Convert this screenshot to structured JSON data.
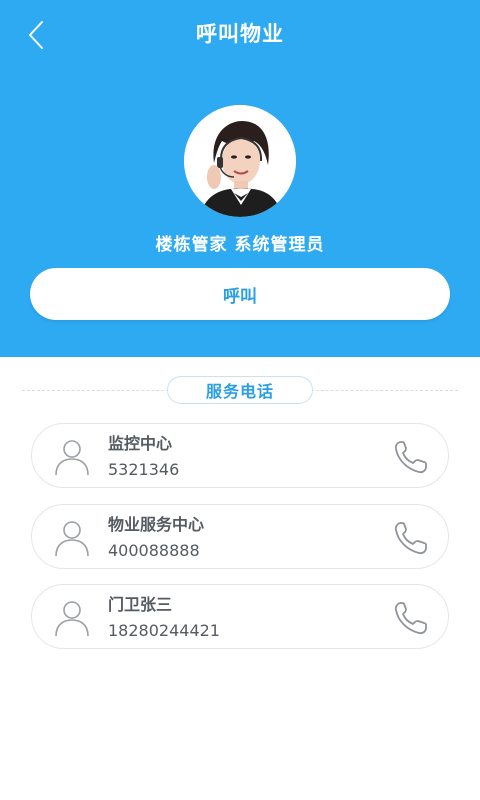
{
  "header": {
    "title": "呼叫物业",
    "back_icon": "chevron-left-icon",
    "background_color": "#2daaf2"
  },
  "manager": {
    "name": "楼栋管家  系统管理员"
  },
  "call_button": {
    "label": "呼叫"
  },
  "service_section": {
    "label": "服务电话",
    "contacts": [
      {
        "name": "监控中心",
        "phone": "5321346",
        "icon": "person-icon",
        "action_icon": "phone-icon"
      },
      {
        "name": "物业服务中心",
        "phone": "400088888",
        "icon": "person-icon",
        "action_icon": "phone-icon"
      },
      {
        "name": "门卫张三",
        "phone": "18280244421",
        "icon": "person-icon",
        "action_icon": "phone-icon"
      }
    ]
  },
  "colors": {
    "accent": "#2a9fe2",
    "text": "#555b61",
    "card_border": "#e3e6ea"
  }
}
